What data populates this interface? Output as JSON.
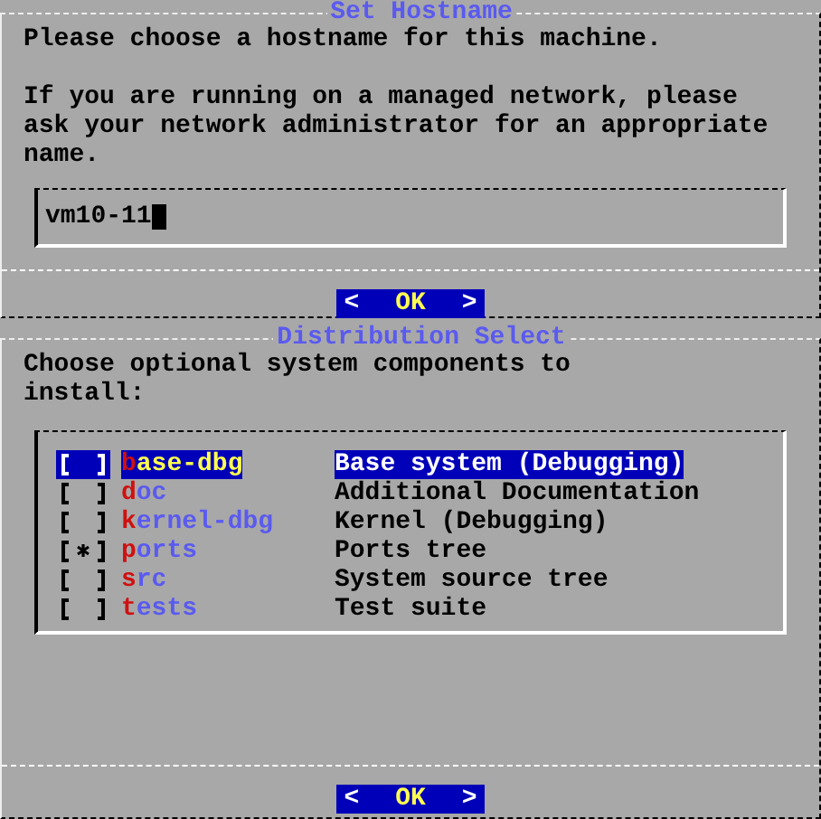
{
  "hostname_dialog": {
    "title": "Set Hostname",
    "prompt": "Please choose a hostname for this machine.",
    "help": "If you are running on a managed network, please ask your network administrator for an appropriate name.",
    "field": {
      "value": "vm10-11"
    },
    "button": {
      "left": "<",
      "label": "OK",
      "right": ">"
    }
  },
  "distribution_dialog": {
    "title": "Distribution Select",
    "prompt": "Choose optional system components to install:",
    "items": [
      {
        "name": "base-dbg",
        "description": "Base system (Debugging)",
        "checked": false,
        "selected": true
      },
      {
        "name": "doc",
        "description": "Additional Documentation",
        "checked": false,
        "selected": false
      },
      {
        "name": "kernel-dbg",
        "description": "Kernel (Debugging)",
        "checked": false,
        "selected": false
      },
      {
        "name": "ports",
        "description": "Ports tree",
        "checked": true,
        "selected": false
      },
      {
        "name": "src",
        "description": "System source tree",
        "checked": false,
        "selected": false
      },
      {
        "name": "tests",
        "description": "Test suite",
        "checked": false,
        "selected": false
      }
    ],
    "button": {
      "left": "<",
      "label": "OK",
      "right": ">"
    }
  }
}
